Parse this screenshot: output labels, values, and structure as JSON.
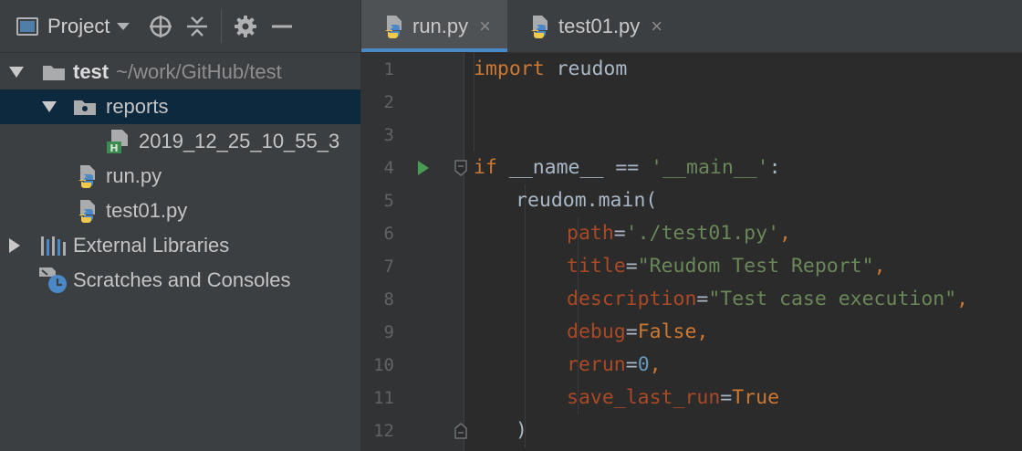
{
  "project_panel": {
    "title": "Project",
    "tree": [
      {
        "label": "test",
        "path": "~/work/GitHub/test"
      },
      {
        "label": "reports"
      },
      {
        "label": "2019_12_25_10_55_3"
      },
      {
        "label": "run.py"
      },
      {
        "label": "test01.py"
      },
      {
        "label": "External Libraries"
      },
      {
        "label": "Scratches and Consoles"
      }
    ]
  },
  "tabs": [
    {
      "label": "run.py",
      "close": "×"
    },
    {
      "label": "test01.py",
      "close": "×"
    }
  ],
  "editor": {
    "line_numbers": [
      "1",
      "2",
      "3",
      "4",
      "5",
      "6",
      "7",
      "8",
      "9",
      "10",
      "11",
      "12"
    ],
    "code": {
      "l1": {
        "kw": "import",
        "rest": " reudom"
      },
      "l4": {
        "kw": "if",
        "a": " __name__ == ",
        "str": "'__main__'",
        "b": ":"
      },
      "l5": {
        "text": "reudom.main("
      },
      "l6": {
        "param": "path",
        "eq": "=",
        "str": "'./test01.py'",
        "comma": ","
      },
      "l7": {
        "param": "title",
        "eq": "=",
        "str": "\"Reudom Test Report\"",
        "comma": ","
      },
      "l8": {
        "param": "description",
        "eq": "=",
        "str": "\"Test case execution\"",
        "comma": ","
      },
      "l9": {
        "param": "debug",
        "eq": "=",
        "val": "False",
        "comma": ","
      },
      "l10": {
        "param": "rerun",
        "eq": "=",
        "val": "0",
        "comma": ","
      },
      "l11": {
        "param": "save_last_run",
        "eq": "=",
        "val": "True"
      },
      "l12": {
        "text": ")"
      }
    }
  }
}
